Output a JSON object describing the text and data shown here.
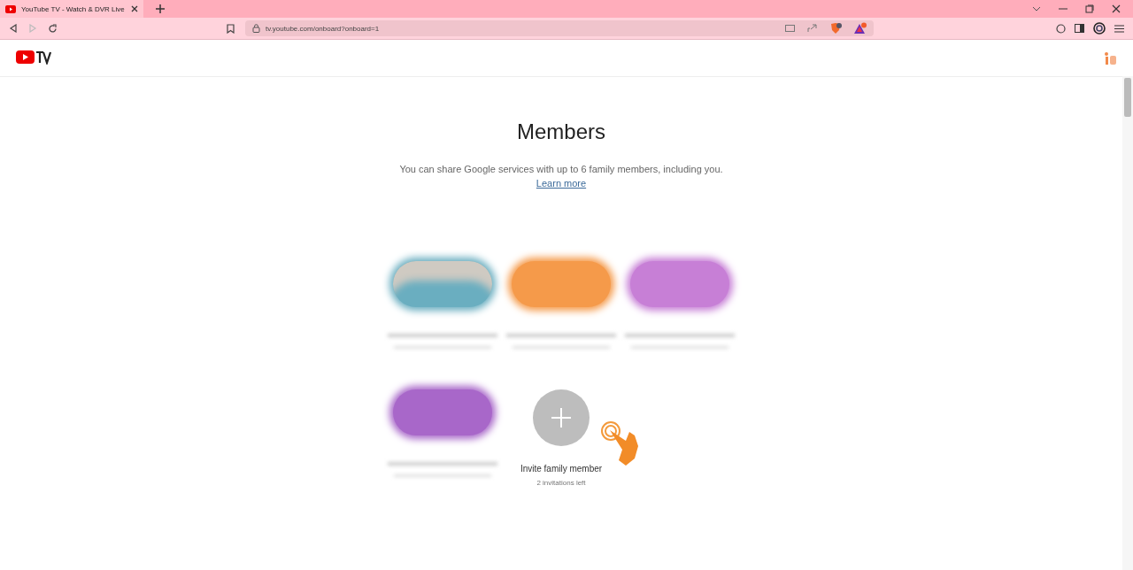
{
  "browser": {
    "tab": {
      "title": "YouTube TV - Watch & DVR Live",
      "selected": true
    },
    "url": "tv.youtube.com/onboard?onboard=1"
  },
  "page": {
    "title": "Members",
    "description": "You can share Google services with up to 6 family members, including you.",
    "link": "Learn more"
  },
  "members": [
    {
      "color": "#6aaec0"
    },
    {
      "color": "#f59a4a"
    },
    {
      "color": "#c77fd6"
    },
    {
      "color": "#a867c9"
    }
  ],
  "invite": {
    "label": "Invite family member",
    "note": "2 invitations left"
  }
}
